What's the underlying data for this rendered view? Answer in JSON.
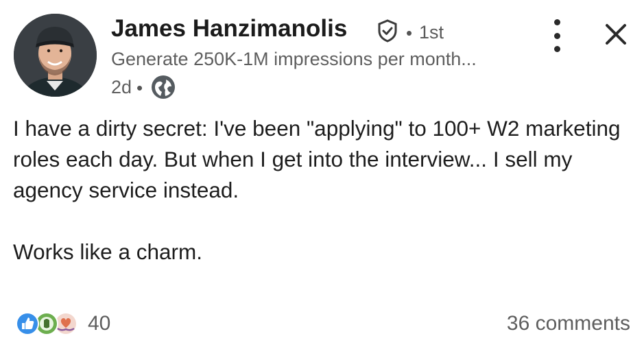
{
  "author": {
    "name": "James Hanzimanolis",
    "verified_icon": "verified-shield-icon",
    "separator": "•",
    "connection_degree": "1st",
    "headline": "Generate 250K-1M impressions per month...",
    "time_ago": "2d",
    "visibility_icon": "globe-icon"
  },
  "actions": {
    "more_icon": "more-vertical-icon",
    "close_icon": "close-icon"
  },
  "post": {
    "paragraphs": [
      "I have a dirty secret: I've been \"applying\" to 100+ W2 marketing roles each day. But when I get into the interview... I sell my agency service instead.",
      "Works like a charm."
    ]
  },
  "social": {
    "reaction_icons": [
      "like-icon",
      "celebrate-icon",
      "support-icon"
    ],
    "reaction_count": "40",
    "comments": "36 comments"
  },
  "colors": {
    "primary_text": "#1d1d1d",
    "secondary_text": "#5e5e5e",
    "like_blue": "#378fe9",
    "celebrate_green": "#44712e",
    "support_purple": "#df704d"
  }
}
